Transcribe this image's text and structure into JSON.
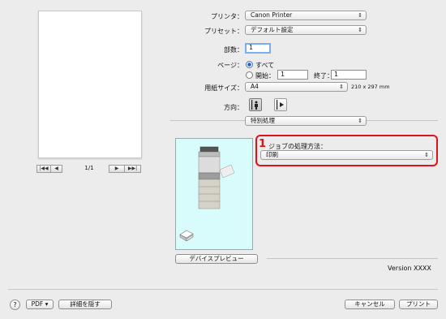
{
  "nav": {
    "first_label": "|◀◀",
    "prev_label": "◀",
    "next_label": "▶",
    "last_label": "▶▶|",
    "page_counter": "1/1"
  },
  "form": {
    "printer_label": "プリンタ：",
    "printer_value": "Canon Printer",
    "preset_label": "プリセット：",
    "preset_value": "デフォルト設定",
    "copies_label": "部数：",
    "copies_value": "1",
    "pages_label": "ページ：",
    "pages_all_label": "すべて",
    "pages_from_label": "開始：",
    "pages_from_value": "1",
    "pages_to_label": "終了：",
    "pages_to_value": "1",
    "paper_label": "用紙サイズ：",
    "paper_value": "A4",
    "paper_dims": "210 x 297 mm",
    "orientation_label": "方向：",
    "section_value": "特別処理"
  },
  "panel": {
    "step_number": "1",
    "job_method_label": "ジョブの処理方法：",
    "job_method_value": "印刷",
    "device_preview_button": "デバイスプレビュー",
    "version": "Version XXXX"
  },
  "footer": {
    "help_label": "?",
    "pdf_label": "PDF ▾",
    "hide_details_label": "詳細を隠す",
    "cancel_label": "キャンセル",
    "print_label": "プリント"
  },
  "icons": {
    "arrows": "up-down-arrows-icon",
    "portrait": "portrait-orientation-icon",
    "landscape": "landscape-orientation-icon",
    "printer": "multifunction-printer-icon",
    "paper_stack": "paper-stack-icon"
  }
}
